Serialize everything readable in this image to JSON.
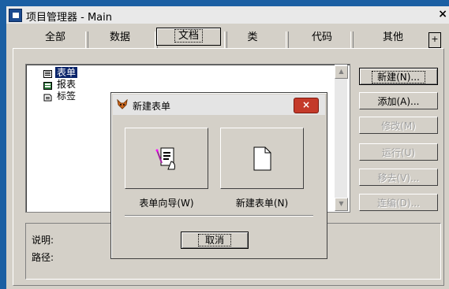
{
  "window": {
    "title": "项目管理器 - Main",
    "close": "×"
  },
  "tabs": [
    {
      "label": "全部"
    },
    {
      "label": "数据"
    },
    {
      "label": "文档",
      "active": true
    },
    {
      "label": "类"
    },
    {
      "label": "代码"
    },
    {
      "label": "其他"
    }
  ],
  "tab_arrow": "+",
  "tree": {
    "items": [
      {
        "label": "表单",
        "icon": "form-icon",
        "selected": true
      },
      {
        "label": "报表",
        "icon": "report-icon"
      },
      {
        "label": "标签",
        "icon": "label-icon"
      }
    ]
  },
  "scroll": {
    "up": "▲",
    "down": "▼"
  },
  "buttons": {
    "new": "新建(N)...",
    "add": "添加(A)...",
    "modify": "修改(M)",
    "run": "运行(U)",
    "remove": "移去(V)...",
    "build": "连编(D)..."
  },
  "info": {
    "description_label": "说明:",
    "path_label": "路径:"
  },
  "dialog": {
    "title": "新建表单",
    "close": "×",
    "wizard_label": "表单向导(W)",
    "new_form_label": "新建表单(N)",
    "cancel": "取消"
  },
  "colors": {
    "desktop": "#1b5fa3",
    "face": "#d4d0c8",
    "selection": "#0a246a",
    "close_red": "#c43a2a"
  }
}
